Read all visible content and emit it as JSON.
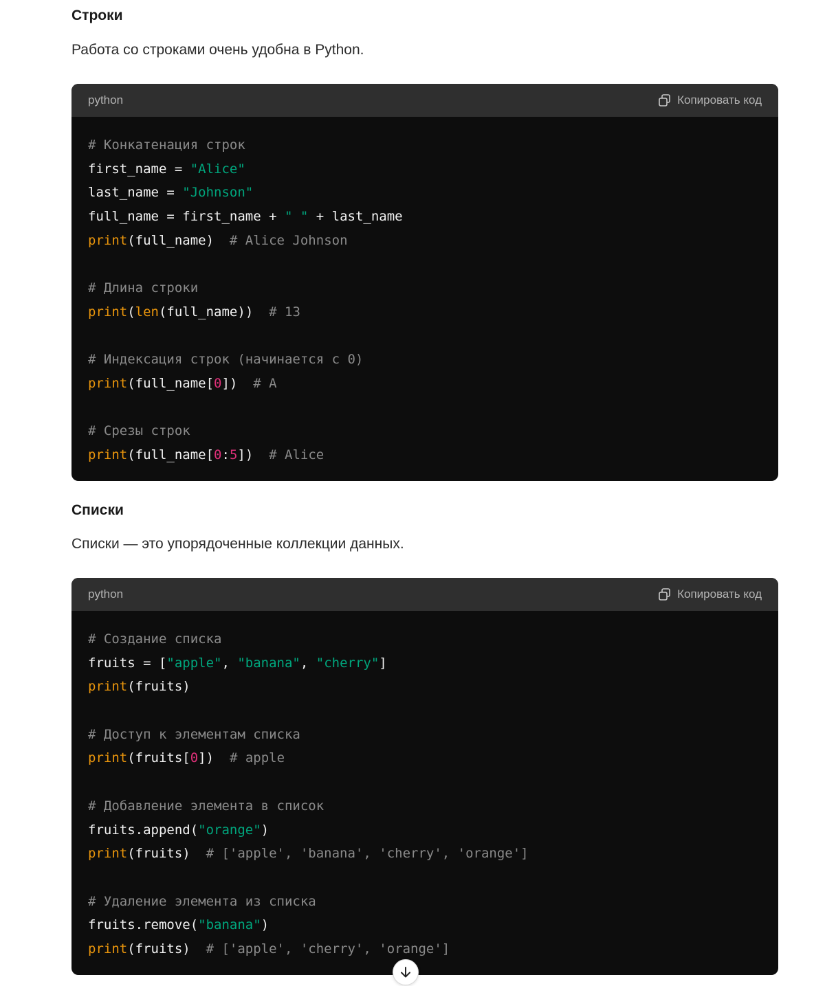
{
  "sections": [
    {
      "heading": "Строки",
      "paragraph": "Работа со строками очень удобна в Python.",
      "code": {
        "language": "python",
        "copy_label": "Копировать код",
        "lines": [
          [
            {
              "t": "# Конкатенация строк",
              "c": "comment"
            }
          ],
          [
            {
              "t": "first_name = ",
              "c": "plain"
            },
            {
              "t": "\"Alice\"",
              "c": "string"
            }
          ],
          [
            {
              "t": "last_name = ",
              "c": "plain"
            },
            {
              "t": "\"Johnson\"",
              "c": "string"
            }
          ],
          [
            {
              "t": "full_name = first_name + ",
              "c": "plain"
            },
            {
              "t": "\" \"",
              "c": "string"
            },
            {
              "t": " + last_name",
              "c": "plain"
            }
          ],
          [
            {
              "t": "print",
              "c": "builtin"
            },
            {
              "t": "(full_name)  ",
              "c": "plain"
            },
            {
              "t": "# Alice Johnson",
              "c": "comment"
            }
          ],
          [],
          [
            {
              "t": "# Длина строки",
              "c": "comment"
            }
          ],
          [
            {
              "t": "print",
              "c": "builtin"
            },
            {
              "t": "(",
              "c": "plain"
            },
            {
              "t": "len",
              "c": "builtin"
            },
            {
              "t": "(full_name))  ",
              "c": "plain"
            },
            {
              "t": "# 13",
              "c": "comment"
            }
          ],
          [],
          [
            {
              "t": "# Индексация строк (начинается с 0)",
              "c": "comment"
            }
          ],
          [
            {
              "t": "print",
              "c": "builtin"
            },
            {
              "t": "(full_name[",
              "c": "plain"
            },
            {
              "t": "0",
              "c": "number"
            },
            {
              "t": "])  ",
              "c": "plain"
            },
            {
              "t": "# A",
              "c": "comment"
            }
          ],
          [],
          [
            {
              "t": "# Срезы строк",
              "c": "comment"
            }
          ],
          [
            {
              "t": "print",
              "c": "builtin"
            },
            {
              "t": "(full_name[",
              "c": "plain"
            },
            {
              "t": "0",
              "c": "number"
            },
            {
              "t": ":",
              "c": "plain"
            },
            {
              "t": "5",
              "c": "number"
            },
            {
              "t": "])  ",
              "c": "plain"
            },
            {
              "t": "# Alice",
              "c": "comment"
            }
          ]
        ]
      }
    },
    {
      "heading": "Списки",
      "paragraph": "Списки — это упорядоченные коллекции данных.",
      "code": {
        "language": "python",
        "copy_label": "Копировать код",
        "lines": [
          [
            {
              "t": "# Создание списка",
              "c": "comment"
            }
          ],
          [
            {
              "t": "fruits = [",
              "c": "plain"
            },
            {
              "t": "\"apple\"",
              "c": "string"
            },
            {
              "t": ", ",
              "c": "plain"
            },
            {
              "t": "\"banana\"",
              "c": "string"
            },
            {
              "t": ", ",
              "c": "plain"
            },
            {
              "t": "\"cherry\"",
              "c": "string"
            },
            {
              "t": "]",
              "c": "plain"
            }
          ],
          [
            {
              "t": "print",
              "c": "builtin"
            },
            {
              "t": "(fruits)",
              "c": "plain"
            }
          ],
          [],
          [
            {
              "t": "# Доступ к элементам списка",
              "c": "comment"
            }
          ],
          [
            {
              "t": "print",
              "c": "builtin"
            },
            {
              "t": "(fruits[",
              "c": "plain"
            },
            {
              "t": "0",
              "c": "number"
            },
            {
              "t": "])  ",
              "c": "plain"
            },
            {
              "t": "# apple",
              "c": "comment"
            }
          ],
          [],
          [
            {
              "t": "# Добавление элемента в список",
              "c": "comment"
            }
          ],
          [
            {
              "t": "fruits.append(",
              "c": "plain"
            },
            {
              "t": "\"orange\"",
              "c": "string"
            },
            {
              "t": ")",
              "c": "plain"
            }
          ],
          [
            {
              "t": "print",
              "c": "builtin"
            },
            {
              "t": "(fruits)  ",
              "c": "plain"
            },
            {
              "t": "# ['apple', 'banana', 'cherry', 'orange']",
              "c": "comment"
            }
          ],
          [],
          [
            {
              "t": "# Удаление элемента из списка",
              "c": "comment"
            }
          ],
          [
            {
              "t": "fruits.remove(",
              "c": "plain"
            },
            {
              "t": "\"banana\"",
              "c": "string"
            },
            {
              "t": ")",
              "c": "plain"
            }
          ],
          [
            {
              "t": "print",
              "c": "builtin"
            },
            {
              "t": "(fruits)  ",
              "c": "plain"
            },
            {
              "t": "# ['apple', 'cherry', 'orange']",
              "c": "comment"
            }
          ]
        ]
      }
    }
  ],
  "scroll_button": {
    "icon": "arrow-down-icon"
  },
  "colors": {
    "code_bg": "#0d0d0d",
    "header_bg": "#2f2f2f",
    "comment": "#8a8a8a",
    "string": "#00a67d",
    "builtin": "#e9950c",
    "number": "#df3079"
  }
}
